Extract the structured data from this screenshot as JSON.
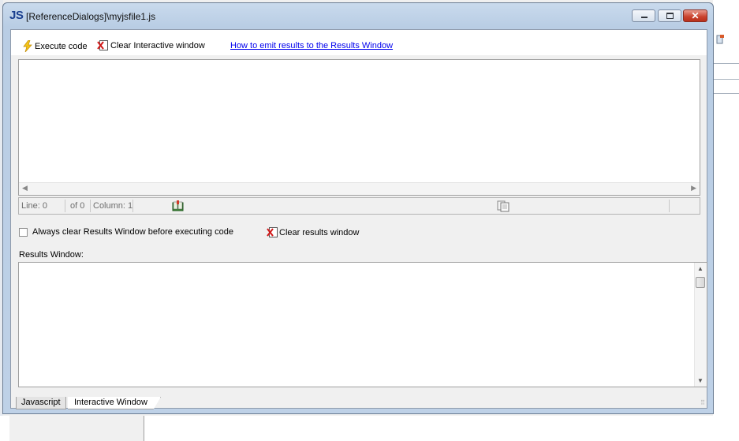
{
  "window": {
    "icon_label": "JS",
    "title": "[ReferenceDialogs]\\myjsfile1.js",
    "controls": {
      "minimize": "minimize-icon",
      "maximize": "maximize-icon",
      "close": "close-icon",
      "close_glyph": "✕"
    }
  },
  "toolbar": {
    "execute_label": "Execute code",
    "clear_interactive_label": "Clear Interactive window",
    "help_link": "How to emit results to the Results Window"
  },
  "editor": {
    "content": ""
  },
  "status": {
    "line": "Line: 0",
    "of": "of 0",
    "column": "Column: 1"
  },
  "options": {
    "always_clear_label": "Always clear Results Window before executing code",
    "always_clear_checked": false,
    "clear_results_label": "Clear results window"
  },
  "results": {
    "label": "Results Window:",
    "content": ""
  },
  "tabs": [
    {
      "label": "Javascript",
      "active": false
    },
    {
      "label": "Interactive Window",
      "active": true
    }
  ],
  "colors": {
    "titlebar": "#c4d6ea",
    "link": "#0000ee",
    "close_button": "#c9412c"
  }
}
